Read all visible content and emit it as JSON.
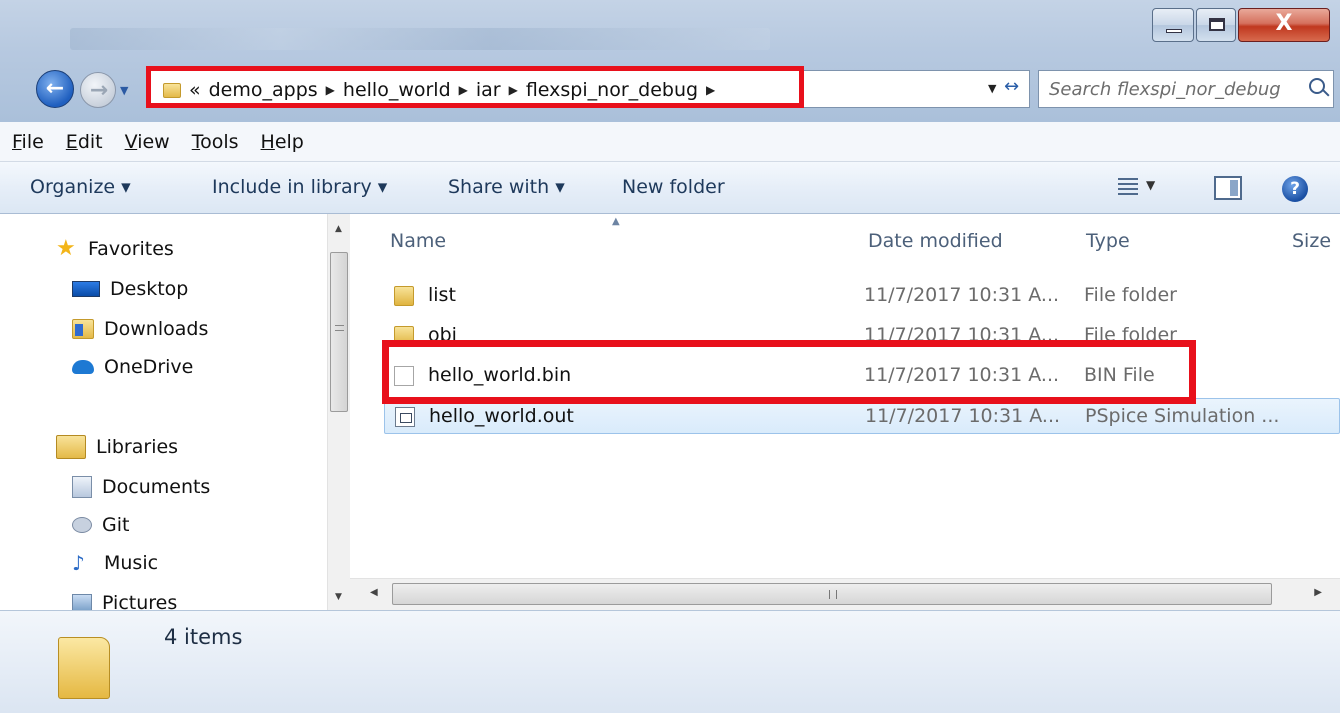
{
  "window": {
    "controls": {
      "minimize": "minimize",
      "maximize": "maximize",
      "close": "X"
    }
  },
  "address": {
    "overflow": "«",
    "crumbs": [
      "demo_apps",
      "hello_world",
      "iar",
      "flexspi_nor_debug"
    ],
    "separator": "▶",
    "dropdown": "▼",
    "refresh": "↔"
  },
  "search": {
    "placeholder": "Search flexspi_nor_debug"
  },
  "menu": [
    "File",
    "Edit",
    "View",
    "Tools",
    "Help"
  ],
  "toolbar": {
    "organize": "Organize ▾",
    "include": "Include in library ▾",
    "share": "Share with ▾",
    "new_folder": "New folder",
    "help": "?"
  },
  "nav": {
    "favorites": "Favorites",
    "desktop": "Desktop",
    "downloads": "Downloads",
    "onedrive": "OneDrive",
    "libraries": "Libraries",
    "documents": "Documents",
    "git": "Git",
    "music": "Music",
    "pictures": "Pictures"
  },
  "columns": {
    "name": "Name",
    "date": "Date modified",
    "type": "Type",
    "size": "Size"
  },
  "files": [
    {
      "name": "list",
      "date": "11/7/2017 10:31 A...",
      "type": "File folder",
      "icon": "folder-icon"
    },
    {
      "name": "obj",
      "date": "11/7/2017 10:31 A...",
      "type": "File folder",
      "icon": "folder-icon"
    },
    {
      "name": "hello_world.bin",
      "date": "11/7/2017 10:31 A...",
      "type": "BIN File",
      "icon": "file-icon"
    },
    {
      "name": "hello_world.out",
      "date": "11/7/2017 10:31 A...",
      "type": "PSpice Simulation ...",
      "icon": "out-file-icon"
    }
  ],
  "status": {
    "count": "4 items"
  },
  "colors": {
    "highlight": "#e8101b",
    "selection": "#d9ebfb",
    "accent": "#1e395b"
  }
}
